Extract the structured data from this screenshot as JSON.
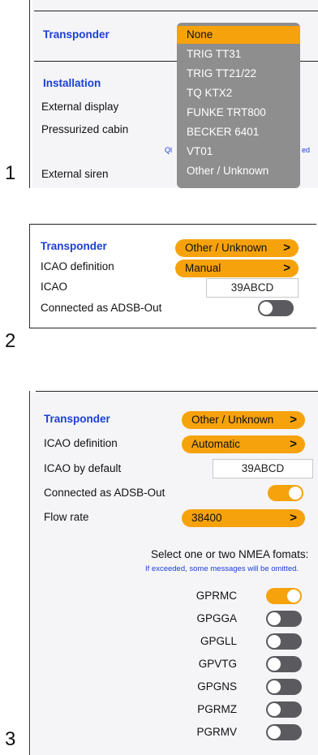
{
  "section1": {
    "number": "1",
    "transponder_heading": "Transponder",
    "installation_heading": "Installation",
    "external_display_label": "External display",
    "pressurized_cabin_label": "Pressurized cabin",
    "external_siren_label": "External siren",
    "hidden_text_left": "Ql",
    "hidden_text_right": "ed",
    "dropdown_options": [
      "None",
      "TRIG TT31",
      "TRIG TT21/22",
      "TQ KTX2",
      "FUNKE TRT800",
      "BECKER 6401",
      "VT01",
      "Other / Unknown"
    ],
    "dropdown_selected": "None"
  },
  "section2": {
    "number": "2",
    "transponder_label": "Transponder",
    "transponder_value": "Other / Unknown",
    "icao_definition_label": "ICAO definition",
    "icao_definition_value": "Manual",
    "icao_label": "ICAO",
    "icao_value": "39ABCD",
    "adsb_out_label": "Connected as ADSB-Out",
    "adsb_out_on": false
  },
  "section3": {
    "number": "3",
    "transponder_label": "Transponder",
    "transponder_value": "Other / Unknown",
    "icao_definition_label": "ICAO definition",
    "icao_definition_value": "Automatic",
    "icao_default_label": "ICAO by default",
    "icao_default_value": "39ABCD",
    "adsb_out_label": "Connected as ADSB-Out",
    "adsb_out_on": true,
    "flow_rate_label": "Flow rate",
    "flow_rate_value": "38400",
    "nmea_heading": "Select one or two NMEA fomats:",
    "nmea_warning": "If exceeded, some messages will be omitted.",
    "nmea_formats": [
      {
        "name": "GPRMC",
        "on": true
      },
      {
        "name": "GPGGA",
        "on": false
      },
      {
        "name": "GPGLL",
        "on": false
      },
      {
        "name": "GPVTG",
        "on": false
      },
      {
        "name": "GPGNS",
        "on": false
      },
      {
        "name": "PGRMZ",
        "on": false
      },
      {
        "name": "PGRMV",
        "on": false
      }
    ]
  },
  "colors": {
    "accent": "#f6a20d",
    "heading_blue": "#1a3fd6",
    "toggle_off": "#5b5b5f",
    "warning_blue": "#1a3fd6"
  },
  "chevron_icon": ">"
}
